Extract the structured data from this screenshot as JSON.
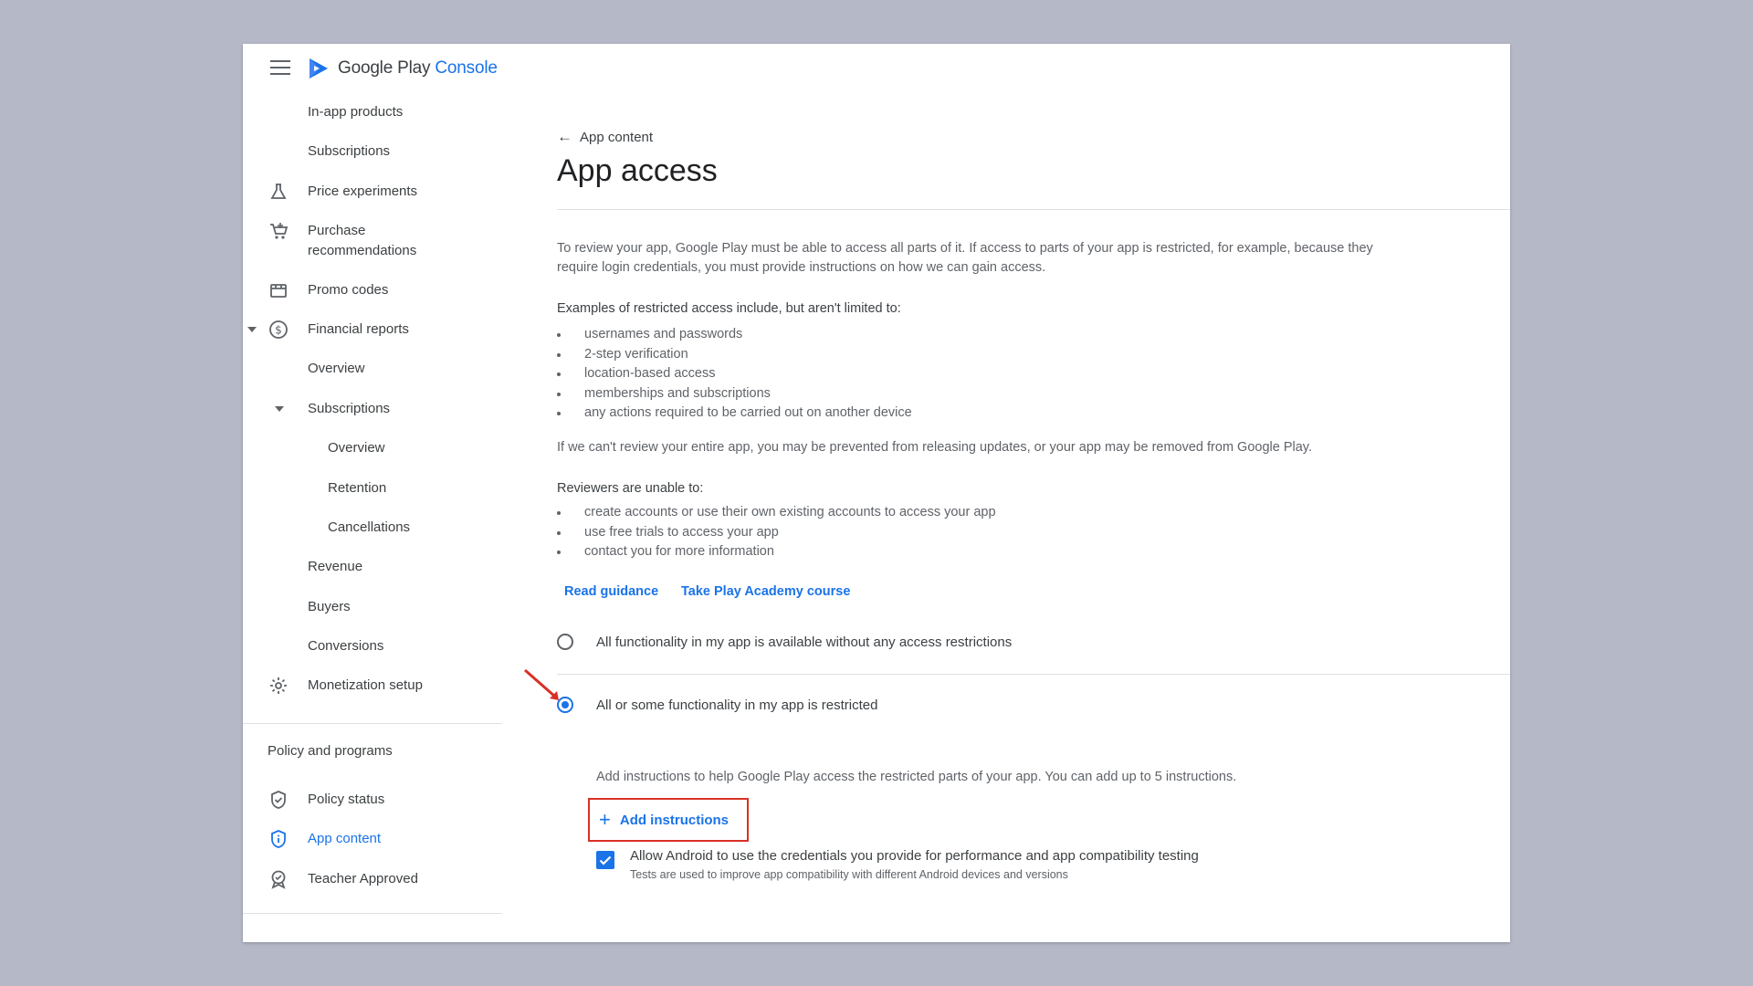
{
  "brand": {
    "name": "Google Play",
    "accent": "Console"
  },
  "sidebar": {
    "items": [
      {
        "label": "In-app products",
        "icon": ""
      },
      {
        "label": "Subscriptions",
        "icon": ""
      },
      {
        "label": "Price experiments",
        "icon": "flask-icon"
      },
      {
        "label": "Purchase recommendations",
        "line1": "Purchase",
        "line2": "recommendations",
        "icon": "cart-icon"
      },
      {
        "label": "Promo codes",
        "icon": "store-icon"
      },
      {
        "label": "Financial reports",
        "icon": "dollar-icon"
      },
      {
        "label": "Overview",
        "icon": ""
      },
      {
        "label": "Subscriptions",
        "icon": ""
      },
      {
        "label": "Overview",
        "icon": ""
      },
      {
        "label": "Retention",
        "icon": ""
      },
      {
        "label": "Cancellations",
        "icon": ""
      },
      {
        "label": "Revenue",
        "icon": ""
      },
      {
        "label": "Buyers",
        "icon": ""
      },
      {
        "label": "Conversions",
        "icon": ""
      },
      {
        "label": "Monetization setup",
        "icon": "gear-icon"
      }
    ],
    "policy_section_title": "Policy and programs",
    "policy_items": [
      {
        "label": "Policy status",
        "icon": "shield-check-icon"
      },
      {
        "label": "App content",
        "icon": "shield-info-icon"
      },
      {
        "label": "Teacher Approved",
        "icon": "badge-icon"
      }
    ]
  },
  "main": {
    "back_label": "App content",
    "title": "App access",
    "intro_line1": "To review your app, Google Play must be able to access all parts of it. If access to parts of your app is restricted, for example, because they",
    "intro_line2": "require login credentials, you must provide instructions on how we can gain access.",
    "examples_heading": "Examples of restricted access include, but aren't limited to:",
    "examples": [
      "usernames and passwords",
      "2-step verification",
      "location-based access",
      "memberships and subscriptions",
      "any actions required to be carried out on another device"
    ],
    "warning": "If we can't review your entire app, you may be prevented from releasing updates, or your app may be removed from Google Play.",
    "reviewers_heading": "Reviewers are unable to:",
    "reviewers": [
      "create accounts or use their own existing accounts to access your app",
      "use free trials to access your app",
      "contact you for more information"
    ],
    "link_guidance": "Read guidance",
    "link_academy": "Take Play Academy course",
    "option_unrestricted": "All functionality in my app is available without any access restrictions",
    "option_restricted": "All or some functionality in my app is restricted",
    "selected_option": "restricted",
    "instructions_hint": "Add instructions to help Google Play access the restricted parts of your app. You can add up to 5 instructions.",
    "add_instructions_label": "Add instructions",
    "checkbox_label": "Allow Android to use the credentials you provide for performance and app compatibility testing",
    "checkbox_sub": "Tests are used to improve app compatibility with different Android devices and versions",
    "checkbox_checked": true
  },
  "colors": {
    "accent": "#1a73e8",
    "highlight": "#d93025",
    "backdrop": "#b5b9c7"
  }
}
